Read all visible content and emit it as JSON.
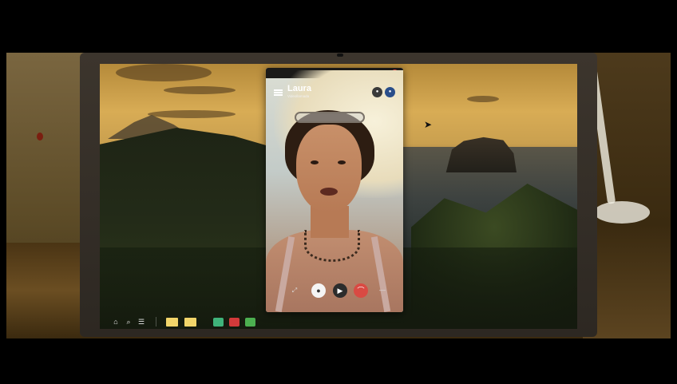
{
  "call": {
    "caller_name": "Laura",
    "subtitle": "Videollamada",
    "close_glyph": "×",
    "top_buttons": [
      "user-icon",
      "info-icon"
    ],
    "controls": {
      "expand_icon": "⤢",
      "mic_icon": "●",
      "video_icon": "▶",
      "hangup_icon": "⌒",
      "more_icon": "—"
    }
  },
  "taskbar": {
    "home_icon": "⌂",
    "search_icon": "⌕",
    "list_icon": "☰",
    "folders": [
      "folder-icon",
      "folder-icon"
    ],
    "apps": [
      "app-green-icon",
      "app-red-icon",
      "app-photo-icon"
    ]
  },
  "colors": {
    "close": "#d13a3a",
    "hangup": "#d94a43",
    "folder": "#f2d56a",
    "app_green": "#3fb37a",
    "app_red": "#d33a3a",
    "app_photo": "#4caf50"
  }
}
